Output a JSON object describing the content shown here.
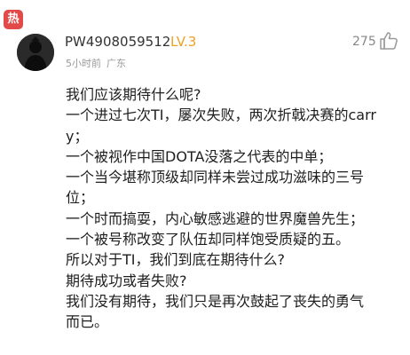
{
  "badge": {
    "label": "热"
  },
  "user": {
    "name": "PW4908059512",
    "level": "LV.3",
    "time": "5小时前",
    "location": "广东"
  },
  "stats": {
    "likes": "275"
  },
  "icons": {
    "like": "thumbs-up-icon"
  },
  "comment": {
    "lines": [
      "我们应该期待什么呢?",
      "一个进过七次TI，屡次失败，两次折戟决赛的carr",
      "y；",
      "一个被视作中国DOTA没落之代表的中单；",
      "一个当今堪称顶级却同样未尝过成功滋味的三号",
      "位；",
      "一个时而搞耍，内心敏感逃避的世界魔兽先生；",
      "一个被号称改变了队伍却同样饱受质疑的五。",
      "所以对于TI，我们到底在期待什么?",
      "期待成功或者失败?",
      "我们没有期待，我们只是再次鼓起了丧失的勇气",
      "而已。"
    ]
  }
}
